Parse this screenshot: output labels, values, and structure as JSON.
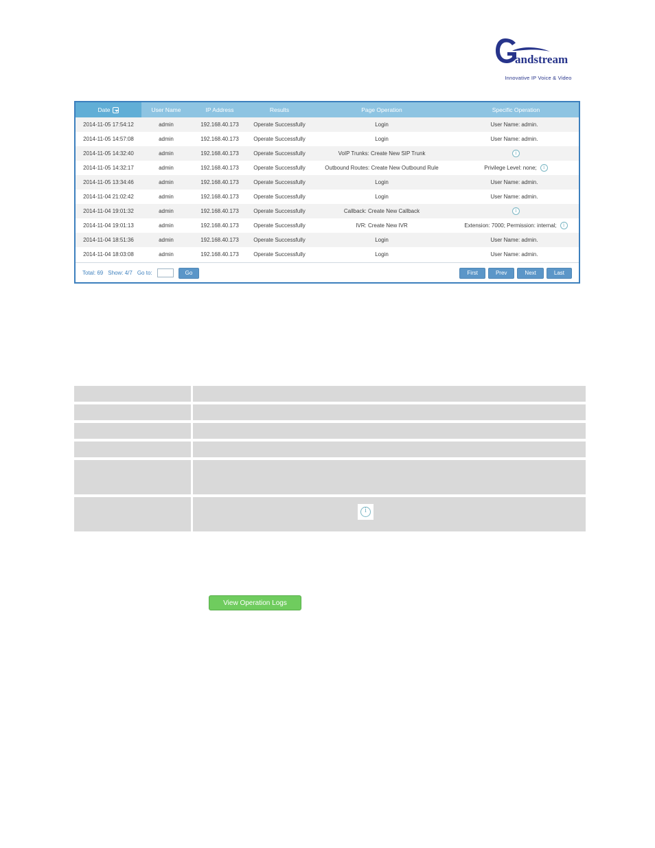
{
  "logo": {
    "brand": "Grandstream",
    "tagline": "Innovative IP Voice & Video",
    "color": "#27348b"
  },
  "log_table": {
    "columns": [
      {
        "label": "Date",
        "sorted": true,
        "icon": "sort-dropdown-icon"
      },
      {
        "label": "User Name",
        "sorted": false
      },
      {
        "label": "IP Address",
        "sorted": false
      },
      {
        "label": "Results",
        "sorted": false
      },
      {
        "label": "Page Operation",
        "sorted": false
      },
      {
        "label": "Specific Operation",
        "sorted": false
      }
    ],
    "rows": [
      {
        "date": "2014-11-05 17:54:12",
        "user": "admin",
        "ip": "192.168.40.173",
        "result": "Operate Successfully",
        "page_op": "Login",
        "spec_op": "User Name: admin.",
        "spec_icon": false
      },
      {
        "date": "2014-11-05 14:57:08",
        "user": "admin",
        "ip": "192.168.40.173",
        "result": "Operate Successfully",
        "page_op": "Login",
        "spec_op": "User Name: admin.",
        "spec_icon": false
      },
      {
        "date": "2014-11-05 14:32:40",
        "user": "admin",
        "ip": "192.168.40.173",
        "result": "Operate Successfully",
        "page_op": "VoIP Trunks: Create New SIP Trunk",
        "spec_op": "",
        "spec_icon": true
      },
      {
        "date": "2014-11-05 14:32:17",
        "user": "admin",
        "ip": "192.168.40.173",
        "result": "Operate Successfully",
        "page_op": "Outbound Routes: Create New Outbound Rule",
        "spec_op": "Privilege Level: none;",
        "spec_icon": true
      },
      {
        "date": "2014-11-05 13:34:46",
        "user": "admin",
        "ip": "192.168.40.173",
        "result": "Operate Successfully",
        "page_op": "Login",
        "spec_op": "User Name: admin.",
        "spec_icon": false
      },
      {
        "date": "2014-11-04 21:02:42",
        "user": "admin",
        "ip": "192.168.40.173",
        "result": "Operate Successfully",
        "page_op": "Login",
        "spec_op": "User Name: admin.",
        "spec_icon": false
      },
      {
        "date": "2014-11-04 19:01:32",
        "user": "admin",
        "ip": "192.168.40.173",
        "result": "Operate Successfully",
        "page_op": "Callback: Create New Callback",
        "spec_op": "",
        "spec_icon": true
      },
      {
        "date": "2014-11-04 19:01:13",
        "user": "admin",
        "ip": "192.168.40.173",
        "result": "Operate Successfully",
        "page_op": "IVR: Create New IVR",
        "spec_op": "Extension: 7000; Permission: internal;",
        "spec_icon": true
      },
      {
        "date": "2014-11-04 18:51:36",
        "user": "admin",
        "ip": "192.168.40.173",
        "result": "Operate Successfully",
        "page_op": "Login",
        "spec_op": "User Name: admin.",
        "spec_icon": false
      },
      {
        "date": "2014-11-04 18:03:08",
        "user": "admin",
        "ip": "192.168.40.173",
        "result": "Operate Successfully",
        "page_op": "Login",
        "spec_op": "User Name: admin.",
        "spec_icon": false
      }
    ]
  },
  "pagination": {
    "total_label": "Total: 69",
    "show_label": "Show: 4/7",
    "goto_label": "Go to:",
    "goto_value": "",
    "go_label": "Go",
    "first_label": "First",
    "prev_label": "Prev",
    "next_label": "Next",
    "last_label": "Last",
    "accent": "#5b96c8"
  },
  "empty_table": {
    "rows": [
      {
        "left": "",
        "right": "",
        "tall": false,
        "icon": false
      },
      {
        "left": "",
        "right": "",
        "tall": false,
        "icon": false
      },
      {
        "left": "",
        "right": "",
        "tall": false,
        "icon": false
      },
      {
        "left": "",
        "right": "",
        "tall": false,
        "icon": false
      },
      {
        "left": "",
        "right": "",
        "tall": true,
        "icon": false
      },
      {
        "left": "",
        "right": "",
        "tall": true,
        "icon": true
      }
    ]
  },
  "action_button": {
    "label": "View Operation Logs",
    "color": "#6fcc5e"
  }
}
